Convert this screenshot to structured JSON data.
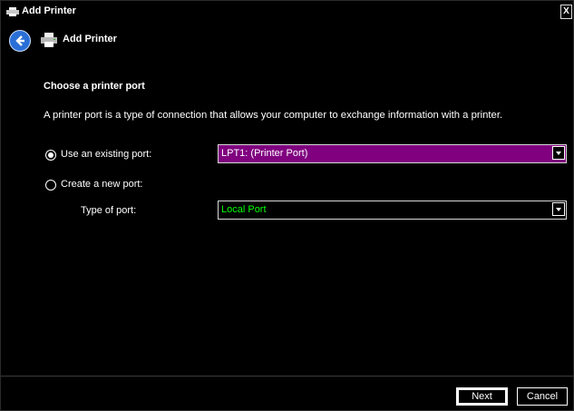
{
  "window": {
    "title": "Add Printer",
    "close_glyph": "X"
  },
  "nav": {
    "title": "Add Printer",
    "back_icon": "back-arrow-icon",
    "printer_icon": "printer-icon"
  },
  "content": {
    "section_title": "Choose a printer port",
    "description": "A printer port is a type of connection that allows your computer to exchange information with a printer.",
    "existing_port": {
      "label": "Use an existing port:",
      "checked": true,
      "value": "LPT1: (Printer Port)",
      "highlight_color": "#800080"
    },
    "new_port": {
      "label": "Create a new port:",
      "checked": false,
      "type_label": "Type of port:",
      "type_value": "Local Port",
      "type_value_color": "#00ff00"
    }
  },
  "footer": {
    "next_label": "Next",
    "cancel_label": "Cancel"
  }
}
